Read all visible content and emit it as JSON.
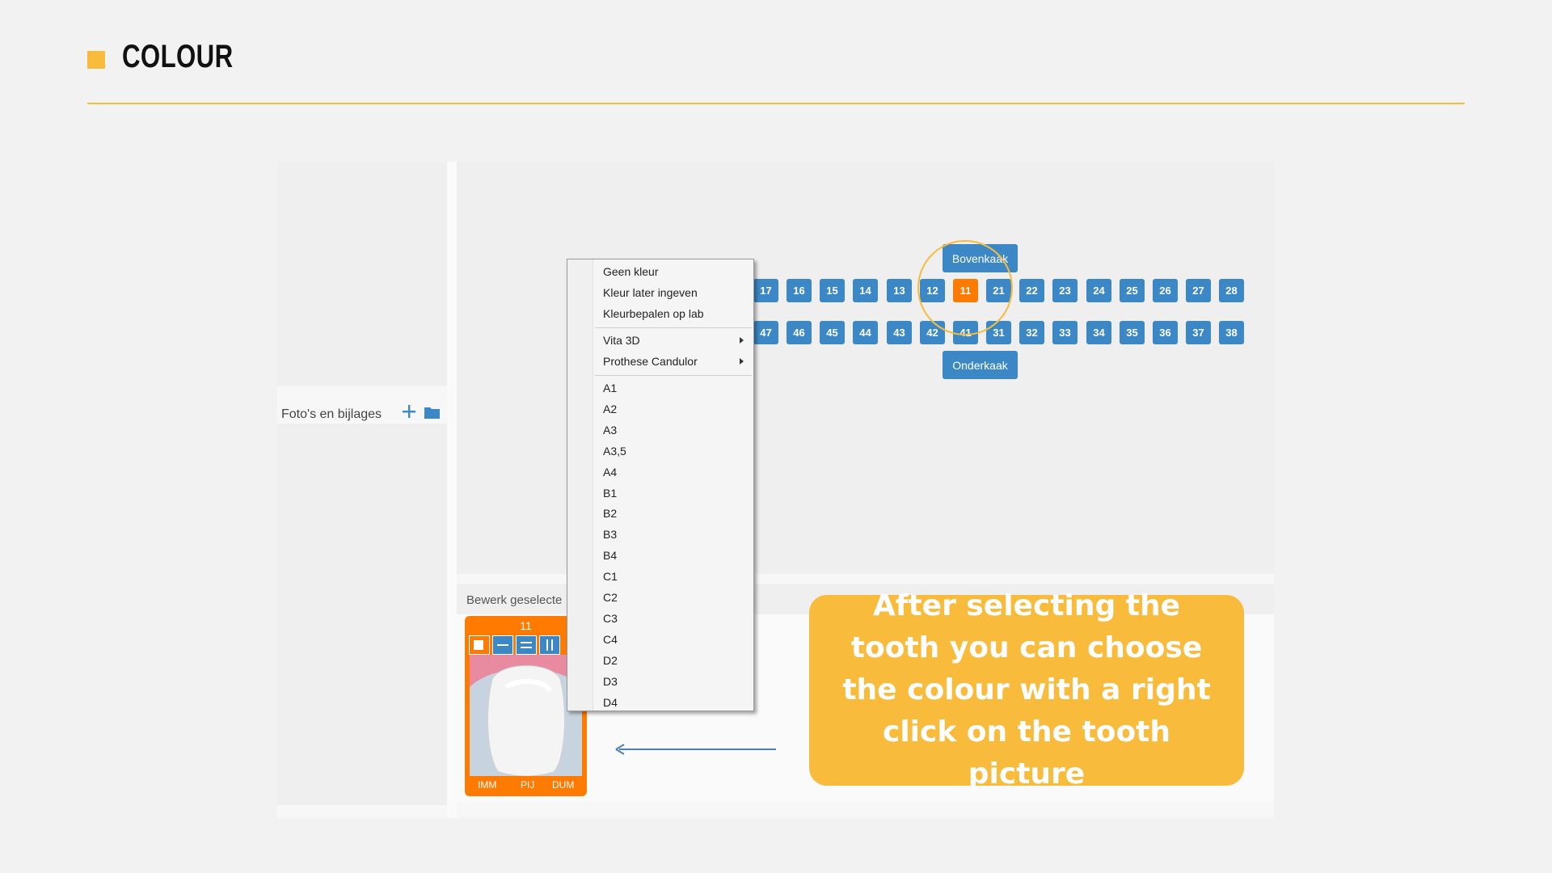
{
  "slide": {
    "title": "COLOUR",
    "accent_color": "#f8bb3b"
  },
  "sidebar": {
    "photos_label": "Foto's en bijlages",
    "add_icon": "plus-icon",
    "folder_icon": "folder-icon"
  },
  "jaw": {
    "upper_label": "Bovenkaak",
    "lower_label": "Onderkaak",
    "upper_teeth": [
      "17",
      "16",
      "15",
      "14",
      "13",
      "12",
      "11",
      "21",
      "22",
      "23",
      "24",
      "25",
      "26",
      "27",
      "28"
    ],
    "lower_teeth": [
      "47",
      "46",
      "45",
      "44",
      "43",
      "42",
      "41",
      "31",
      "32",
      "33",
      "34",
      "35",
      "36",
      "37",
      "38"
    ],
    "selected_tooth": "11",
    "tooth_color": "#3c88c6",
    "selected_color": "#ff7a00"
  },
  "bottom": {
    "header_label": "Bewerk geselecte"
  },
  "tooth_card": {
    "number": "11",
    "footer": [
      "IMM",
      "PIJ",
      "DUM"
    ]
  },
  "context_menu": {
    "group1": [
      "Geen kleur",
      "Kleur later ingeven",
      "Kleurbepalen op lab"
    ],
    "group2": [
      "Vita 3D",
      "Prothese Candulor"
    ],
    "group3": [
      "A1",
      "A2",
      "A3",
      "A3,5",
      "A4",
      "B1",
      "B2",
      "B3",
      "B4",
      "C1",
      "C2",
      "C3",
      "C4",
      "D2",
      "D3",
      "D4"
    ]
  },
  "callout": {
    "text": "After selecting the tooth you can choose the colour with a right click on the tooth picture"
  }
}
